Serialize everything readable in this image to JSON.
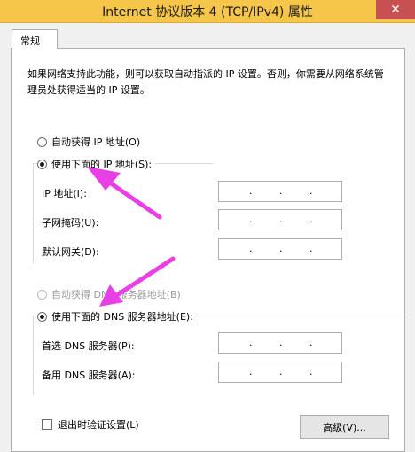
{
  "window": {
    "title": "Internet 协议版本 4 (TCP/IPv4) 属性",
    "close_glyph": "✕"
  },
  "tab": {
    "label": "常规"
  },
  "description": "如果网络支持此功能，则可以获取自动指派的 IP 设置。否则，你需要从网络系统管理员处获得适当的 IP 设置。",
  "ip_section": {
    "auto_label": "自动获得 IP 地址(O)",
    "manual_label": "使用下面的 IP 地址(S):",
    "selected": "manual",
    "fields": [
      {
        "label": "IP 地址(I):",
        "value": ""
      },
      {
        "label": "子网掩码(U):",
        "value": ""
      },
      {
        "label": "默认网关(D):",
        "value": ""
      }
    ]
  },
  "dns_section": {
    "auto_label": "自动获得 DNS 服务器地址(B)",
    "auto_disabled": true,
    "manual_label": "使用下面的 DNS 服务器地址(E):",
    "selected": "manual",
    "fields": [
      {
        "label": "首选 DNS 服务器(P):",
        "value": ""
      },
      {
        "label": "备用 DNS 服务器(A):",
        "value": ""
      }
    ]
  },
  "validate_label": "退出时验证设置(L)",
  "validate_checked": false,
  "advanced_button": "高级(V)...",
  "ip_separator": ".",
  "annotation_color": "#e83fe6"
}
